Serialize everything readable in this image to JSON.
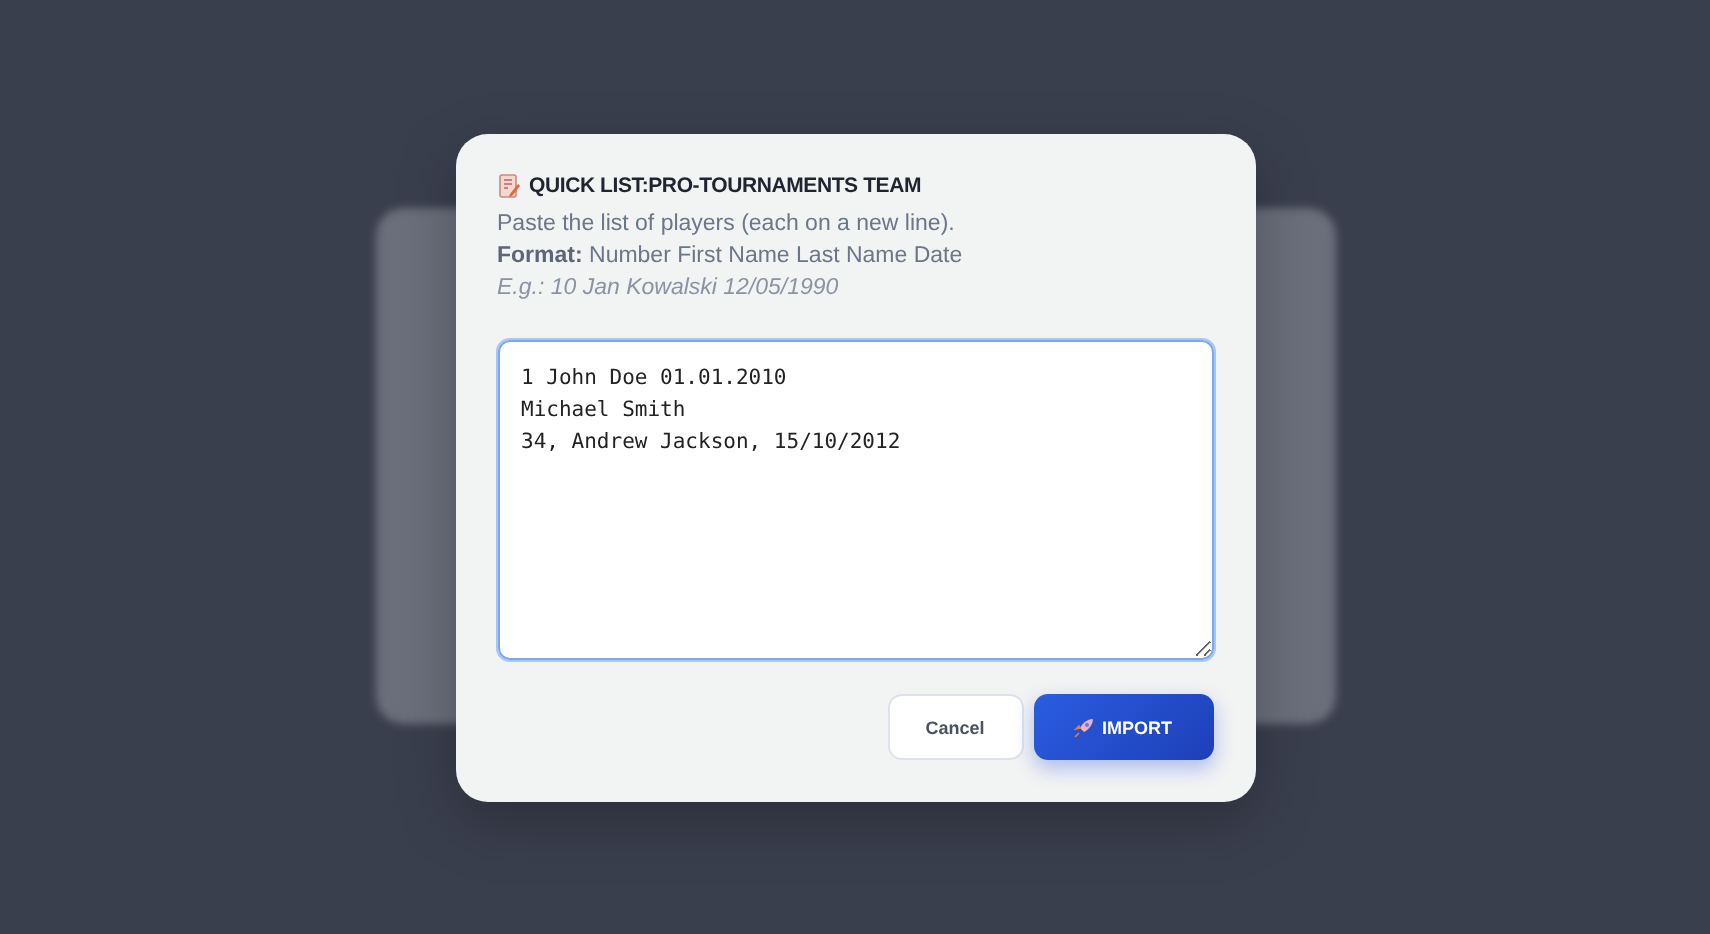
{
  "dialog": {
    "title": "QUICK LIST:PRO-TOURNAMENTS TEAM",
    "instructions": [
      "Paste the list of players (each on a new line).",
      "**Format:** Number First Name Last Name Date"
    ],
    "example": "E.g.: 10 Jan Kowalski 12/05/1990",
    "players_field": {
      "value": "1 John Doe 01.01.2010\nMichael Smith\n34, Andrew Jackson, 15/10/2012",
      "focused": true
    },
    "buttons": [
      {
        "label": "Cancel",
        "kind": "secondary"
      },
      {
        "label": "IMPORT",
        "kind": "primary"
      }
    ]
  }
}
